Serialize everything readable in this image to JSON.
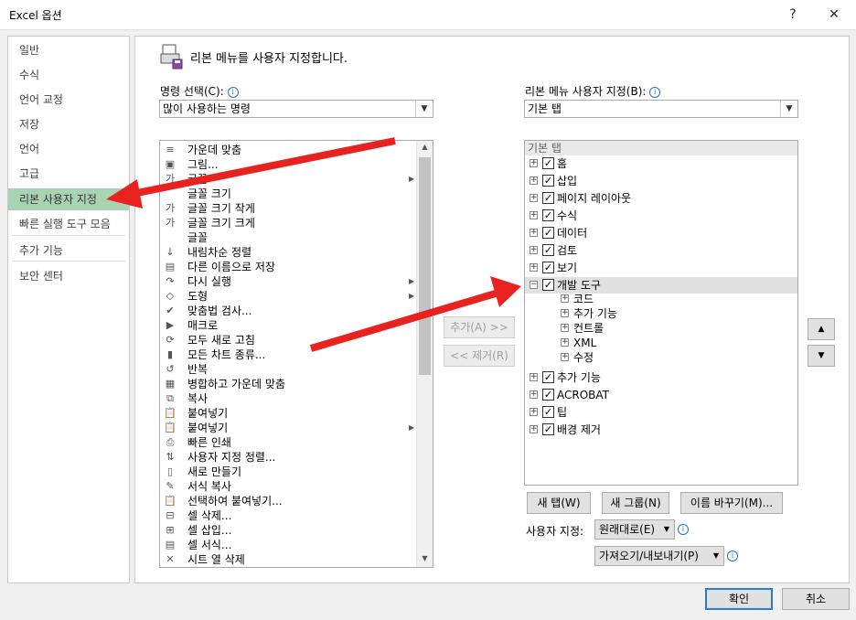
{
  "window": {
    "title": "Excel 옵션",
    "help": "?",
    "close": "✕"
  },
  "nav": {
    "items": [
      "일반",
      "수식",
      "언어 교정",
      "저장",
      "언어",
      "고급",
      "리본 사용자 지정",
      "빠른 실행 도구 모음",
      "추가 기능",
      "보안 센터"
    ],
    "selected_index": 6
  },
  "header": {
    "text": "리본 메뉴를 사용자 지정합니다."
  },
  "left": {
    "label": "명령 선택(C):",
    "dropdown": "많이 사용하는 명령",
    "commands": [
      {
        "label": "가운데 맞춤",
        "icon": "≡"
      },
      {
        "label": "그림...",
        "icon": "▣"
      },
      {
        "label": "글꼴",
        "icon": "가"
      },
      {
        "label": "글꼴 크기",
        "icon": " "
      },
      {
        "label": "글꼴 크기 작게",
        "icon": "가"
      },
      {
        "label": "글꼴 크기 크게",
        "icon": "가"
      },
      {
        "label": "글꼴",
        "icon": " "
      },
      {
        "label": "내림차순 정렬",
        "icon": "↓"
      },
      {
        "label": "다른 이름으로 저장",
        "icon": "▤"
      },
      {
        "label": "다시 실행",
        "icon": "↷"
      },
      {
        "label": "도형",
        "icon": "◇"
      },
      {
        "label": "맞춤법 검사...",
        "icon": "✔"
      },
      {
        "label": "매크로",
        "icon": "▶"
      },
      {
        "label": "모두 새로 고침",
        "icon": "⟳"
      },
      {
        "label": "모든 차트 종류...",
        "icon": "▮"
      },
      {
        "label": "반복",
        "icon": "↺"
      },
      {
        "label": "병합하고 가운데 맞춤",
        "icon": "▦"
      },
      {
        "label": "복사",
        "icon": "⧉"
      },
      {
        "label": "붙여넣기",
        "icon": "📋"
      },
      {
        "label": "붙여넣기",
        "icon": "📋"
      },
      {
        "label": "빠른 인쇄",
        "icon": "⎙"
      },
      {
        "label": "사용자 지정 정렬...",
        "icon": "⇅"
      },
      {
        "label": "새로 만들기",
        "icon": "▯"
      },
      {
        "label": "서식 복사",
        "icon": "✎"
      },
      {
        "label": "선택하여 붙여넣기...",
        "icon": "📋"
      },
      {
        "label": "셀 삭제...",
        "icon": "⊟"
      },
      {
        "label": "셀 삽입...",
        "icon": "⊞"
      },
      {
        "label": "셀 서식...",
        "icon": "▤"
      },
      {
        "label": "시트 열 삭제",
        "icon": "✕"
      }
    ]
  },
  "middle": {
    "add": "추가(A) >>",
    "remove": "<< 제거(R)"
  },
  "right": {
    "label": "리본 메뉴 사용자 지정(B):",
    "dropdown": "기본 탭",
    "tree_header": "기본 탭",
    "tabs": [
      {
        "label": "홈",
        "checked": true,
        "expanded": false
      },
      {
        "label": "삽입",
        "checked": true,
        "expanded": false
      },
      {
        "label": "페이지 레이아웃",
        "checked": true,
        "expanded": false
      },
      {
        "label": "수식",
        "checked": true,
        "expanded": false
      },
      {
        "label": "데이터",
        "checked": true,
        "expanded": false
      },
      {
        "label": "검토",
        "checked": true,
        "expanded": false
      },
      {
        "label": "보기",
        "checked": true,
        "expanded": false
      },
      {
        "label": "개발 도구",
        "checked": true,
        "expanded": true,
        "children": [
          "코드",
          "추가 기능",
          "컨트롤",
          "XML",
          "수정"
        ]
      },
      {
        "label": "추가 기능",
        "checked": true,
        "expanded": false
      },
      {
        "label": "ACROBAT",
        "checked": true,
        "expanded": false
      },
      {
        "label": "팁",
        "checked": true,
        "expanded": false
      },
      {
        "label": "배경 제거",
        "checked": true,
        "expanded": false
      }
    ],
    "new_tab": "새 탭(W)",
    "new_group": "새 그룹(N)",
    "rename": "이름 바꾸기(M)...",
    "custom_label": "사용자 지정:",
    "reset": "원래대로(E)",
    "import_export": "가져오기/내보내기(P)"
  },
  "footer": {
    "ok": "확인",
    "cancel": "취소"
  },
  "colors": {
    "accent": "#a9d4b3",
    "arrow": "#e8231f"
  }
}
